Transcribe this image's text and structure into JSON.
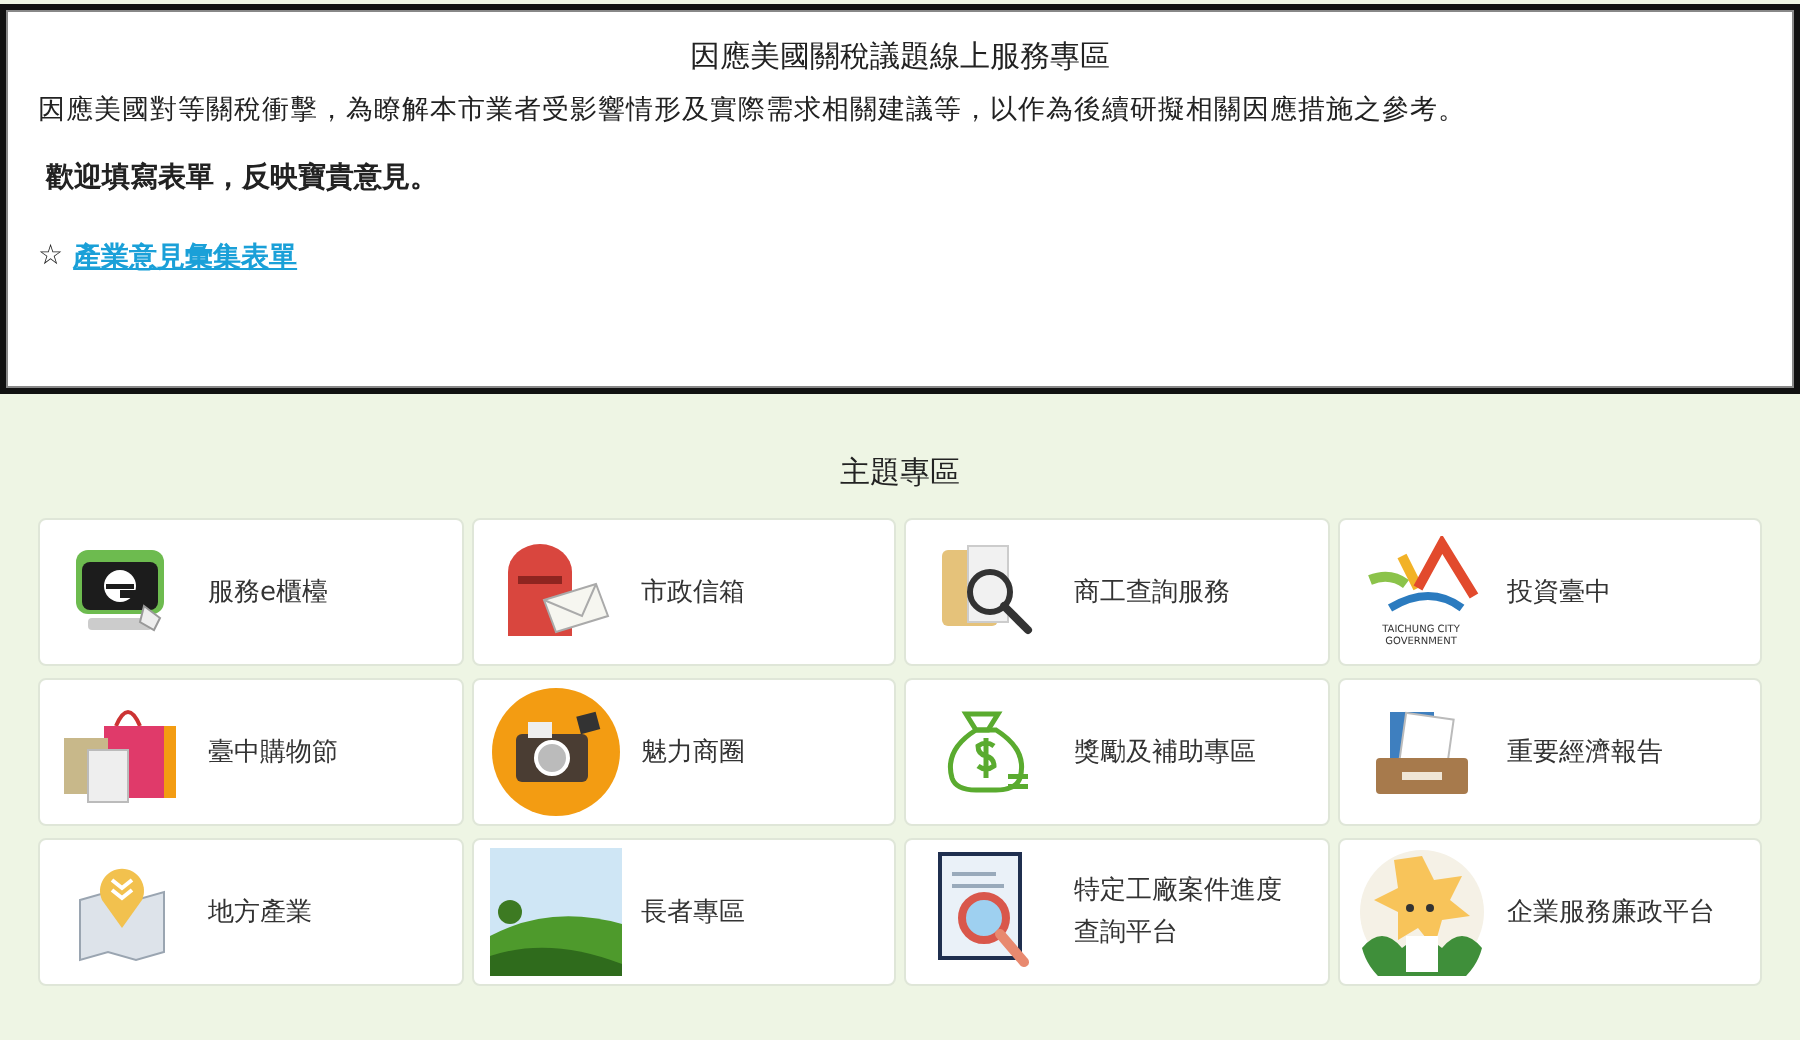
{
  "notice": {
    "title": "因應美國關稅議題線上服務專區",
    "description": "因應美國對等關稅衝擊，為瞭解本市業者受影響情形及實際需求相關建議等，以作為後續研擬相關因應措施之參考。",
    "invitation": "歡迎填寫表單，反映寶貴意見。",
    "link_marker": "☆",
    "link": "產業意見彙集表單"
  },
  "topics": {
    "heading": "主題專區",
    "tiles": [
      {
        "label": "服務e櫃檯",
        "kind": "computer"
      },
      {
        "label": "市政信箱",
        "kind": "mailbox"
      },
      {
        "label": "商工查詢服務",
        "kind": "folder"
      },
      {
        "label": "投資臺中",
        "kind": "logo",
        "logo_text": "TAICHUNG CITY GOVERNMENT"
      },
      {
        "label": "臺中購物節",
        "kind": "bags"
      },
      {
        "label": "魅力商圈",
        "kind": "camera"
      },
      {
        "label": "獎勵及補助專區",
        "kind": "money"
      },
      {
        "label": "重要經濟報告",
        "kind": "drawer"
      },
      {
        "label": "地方產業",
        "kind": "map"
      },
      {
        "label": "長者專區",
        "kind": "landscape"
      },
      {
        "label": "特定工廠案件進度查詢平台",
        "kind": "document"
      },
      {
        "label": "企業服務廉政平台",
        "kind": "mascot"
      }
    ]
  }
}
